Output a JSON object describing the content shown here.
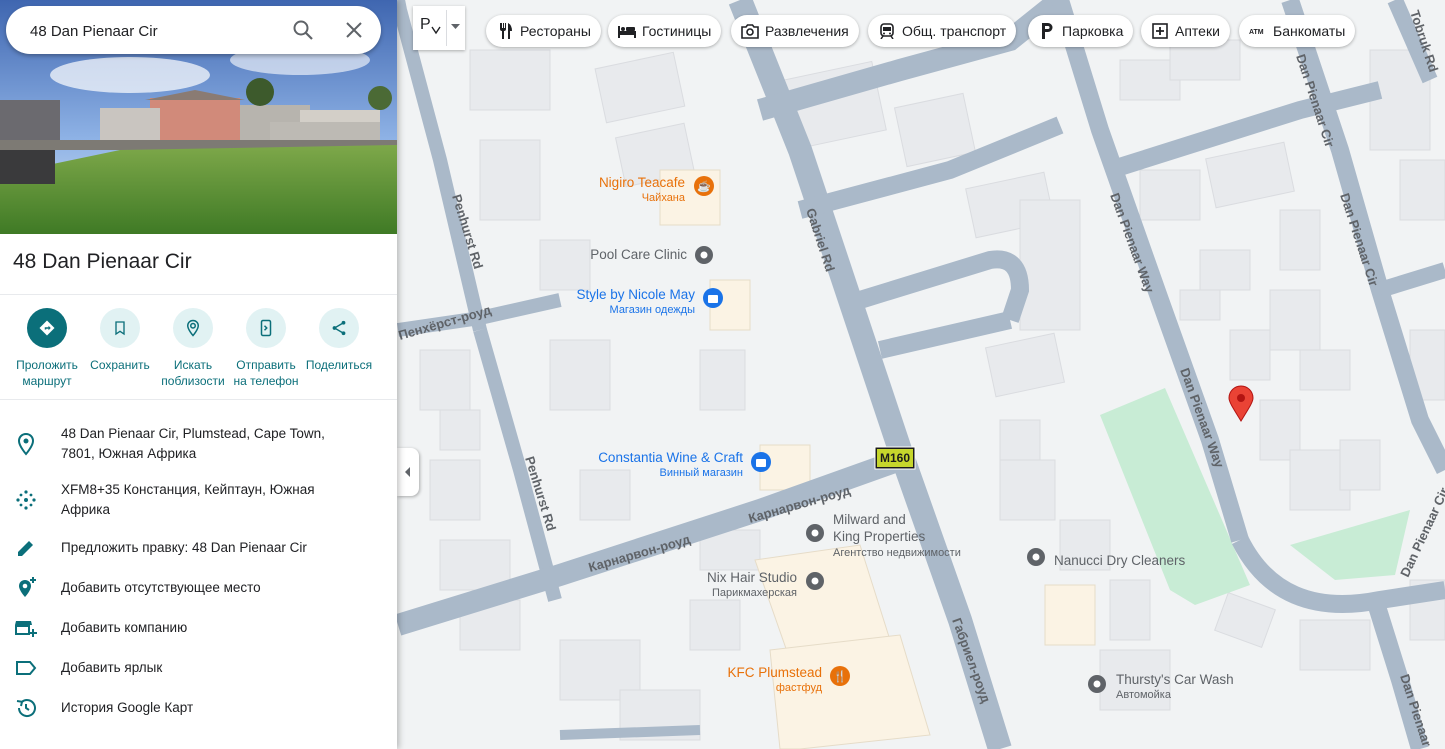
{
  "search": {
    "value": "48 Dan Pienaar Cir"
  },
  "place": {
    "title": "48 Dan Pienaar Cir"
  },
  "actions": [
    {
      "label": "Проложить маршрут",
      "icon": "directions-icon"
    },
    {
      "label": "Сохранить",
      "icon": "bookmark-icon"
    },
    {
      "label": "Искать поблизости",
      "icon": "nearby-icon"
    },
    {
      "label": "Отправить на телефон",
      "icon": "send-to-phone-icon"
    },
    {
      "label": "Поделиться",
      "icon": "share-icon"
    }
  ],
  "info": [
    {
      "text": "48 Dan Pienaar Cir, Plumstead, Cape Town, 7801, Южная Африка",
      "icon": "location-pin-icon"
    },
    {
      "text": "XFM8+35 Констанция, Кейптаун, Южная Африка",
      "icon": "plus-code-icon"
    },
    {
      "text": "Предложить правку: 48 Dan Pienaar Cir",
      "icon": "edit-pencil-icon"
    },
    {
      "text": "Добавить отсутствующее место",
      "icon": "add-place-icon"
    },
    {
      "text": "Добавить компанию",
      "icon": "add-business-icon"
    },
    {
      "text": "Добавить ярлык",
      "icon": "label-icon"
    },
    {
      "text": "История Google Карт",
      "icon": "history-icon"
    }
  ],
  "chips": [
    {
      "label": "Рестораны",
      "icon": "restaurant-icon"
    },
    {
      "label": "Гостиницы",
      "icon": "hotel-icon"
    },
    {
      "label": "Развлечения",
      "icon": "camera-icon"
    },
    {
      "label": "Общ. транспорт",
      "icon": "transit-icon"
    },
    {
      "label": "Парковка",
      "icon": "parking-icon"
    },
    {
      "label": "Аптеки",
      "icon": "pharmacy-icon"
    },
    {
      "label": "Банкоматы",
      "icon": "atm-icon"
    }
  ],
  "layers": {
    "label": "Р"
  },
  "map": {
    "roads": {
      "penhurst_1": "Penhurst Rd",
      "penhurst_2": "Penhurst Rd",
      "gabriel_en": "Gabriel Rd",
      "gabriel_ru": "Габриел-роуд",
      "carnarvon_1": "Карнарвон-роуд",
      "carnarvon_2": "Карнарвон-роуд",
      "dan_1": "Dan Pienaar Way",
      "dan_2": "Dan Pienaar Way",
      "dan_cir_1": "Dan Pienaar Cir",
      "dan_cir_2": "Dan Pienaar Cir",
      "dan_cir_3": "Dan Pienaar Cir",
      "dan_cir_4": "Dan Pienaar Cir",
      "tobruk": "Tobruk Rd",
      "left_road": "Пенхёрст-роуд"
    },
    "route_shield": "M160",
    "pois": [
      {
        "name": "Nigiro Teacafe",
        "category": "Чайхана",
        "color": "#e8710a",
        "icon": "cafe-icon"
      },
      {
        "name": "Pool Care Clinic",
        "category": "",
        "color": "#5f6368",
        "icon": "pin-icon"
      },
      {
        "name": "Style by Nicole May",
        "category": "Магазин одежды",
        "color": "#1a73e8",
        "icon": "shopping-icon"
      },
      {
        "name": "Constantia Wine & Craft",
        "category": "Винный магазин",
        "color": "#1a73e8",
        "icon": "shopping-icon"
      },
      {
        "name": "Milward and King Properties",
        "category": "Агентство недвижимости",
        "color": "#5f6368",
        "icon": "pin-icon"
      },
      {
        "name": "Nix Hair Studio",
        "category": "Парикмахерская",
        "color": "#5f6368",
        "icon": "pin-icon"
      },
      {
        "name": "KFC Plumstead",
        "category": "фастфуд",
        "color": "#e8710a",
        "icon": "restaurant-icon"
      },
      {
        "name": "Nanucci Dry Cleaners",
        "category": "",
        "color": "#5f6368",
        "icon": "pin-icon"
      },
      {
        "name": "Thursty's Car Wash",
        "category": "Автомойка",
        "color": "#5f6368",
        "icon": "pin-icon"
      }
    ]
  },
  "colors": {
    "accent": "#0b6f7a",
    "road": "#aab9c9",
    "park": "#c8ecd5",
    "building": "#e8eaed",
    "marker": "#ea4335"
  }
}
